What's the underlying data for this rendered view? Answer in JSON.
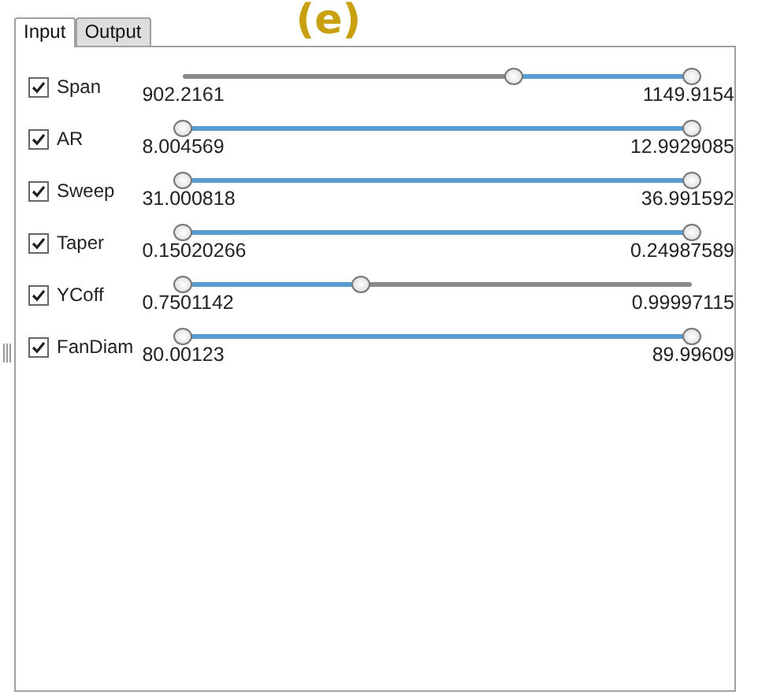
{
  "tabs": [
    {
      "label": "Input",
      "selected": true
    },
    {
      "label": "Output",
      "selected": false
    }
  ],
  "figure_label": "(e)",
  "parameters": [
    {
      "name": "Span",
      "checked": true,
      "min": "902.2161",
      "max": "1149.9154",
      "thumbs": [
        {
          "level": 0.65
        },
        {
          "level": 1
        }
      ]
    },
    {
      "name": "AR",
      "checked": true,
      "min": "8.004569",
      "max": "12.9929085",
      "thumbs": [
        {
          "level": 0
        },
        {
          "level": 1
        }
      ]
    },
    {
      "name": "Sweep",
      "checked": true,
      "min": "31.000818",
      "max": "36.991592",
      "thumbs": [
        {
          "level": 0
        },
        {
          "level": 1
        }
      ]
    },
    {
      "name": "Taper",
      "checked": true,
      "min": "0.15020266",
      "max": "0.24987589",
      "thumbs": [
        {
          "level": 0
        },
        {
          "level": 1
        }
      ]
    },
    {
      "name": "YCoff",
      "checked": true,
      "min": "0.7501142",
      "max": "0.99997115",
      "thumbs": [
        {
          "level": 0
        },
        {
          "level": 0.35
        }
      ]
    },
    {
      "name": "FanDiam",
      "checked": true,
      "min": "80.00123",
      "max": "89.99609",
      "thumbs": [
        {
          "level": 0
        },
        {
          "level": 1
        }
      ]
    }
  ]
}
